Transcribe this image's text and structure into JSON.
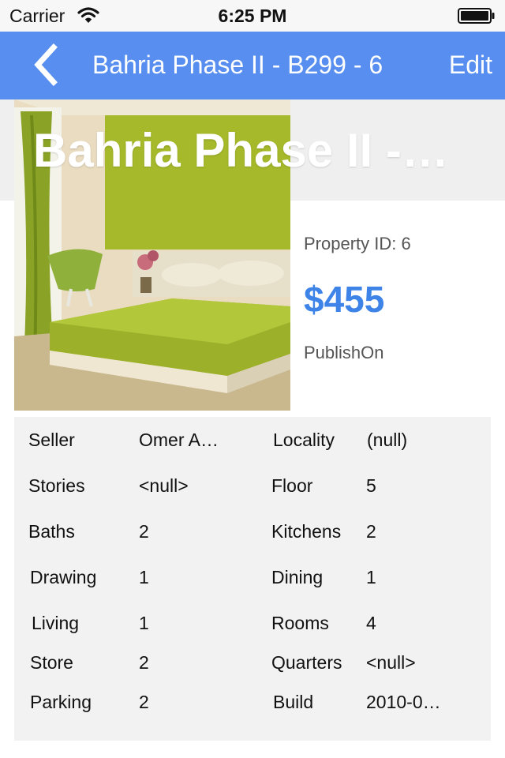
{
  "status_bar": {
    "carrier": "Carrier",
    "time": "6:25 PM"
  },
  "nav": {
    "title": "Bahria Phase II - B299 - 6",
    "edit_label": "Edit"
  },
  "hero": {
    "title": "Bahria Phase II -…",
    "property_id": "Property ID: 6",
    "price": "$455",
    "publish": "PublishOn"
  },
  "details": [
    {
      "label": "Seller",
      "value": "Omer A…",
      "label2": "Locality",
      "value2": "(null)"
    },
    {
      "label": "Stories",
      "value": "<null>",
      "label2": "Floor",
      "value2": "5"
    },
    {
      "label": "Baths",
      "value": "2",
      "label2": "Kitchens",
      "value2": "2"
    },
    {
      "label": "Drawing",
      "value": "1",
      "label2": "Dining",
      "value2": "1"
    },
    {
      "label": "Living",
      "value": "1",
      "label2": "Rooms",
      "value2": "4"
    },
    {
      "label": "Store",
      "value": "2",
      "label2": "Quarters",
      "value2": "<null>"
    },
    {
      "label": "Parking",
      "value": "2",
      "label2": "Build",
      "value2": "2010-0…"
    }
  ],
  "colors": {
    "nav": "#578ef0",
    "price": "#3e84e8",
    "panel": "#f2f2f2"
  }
}
